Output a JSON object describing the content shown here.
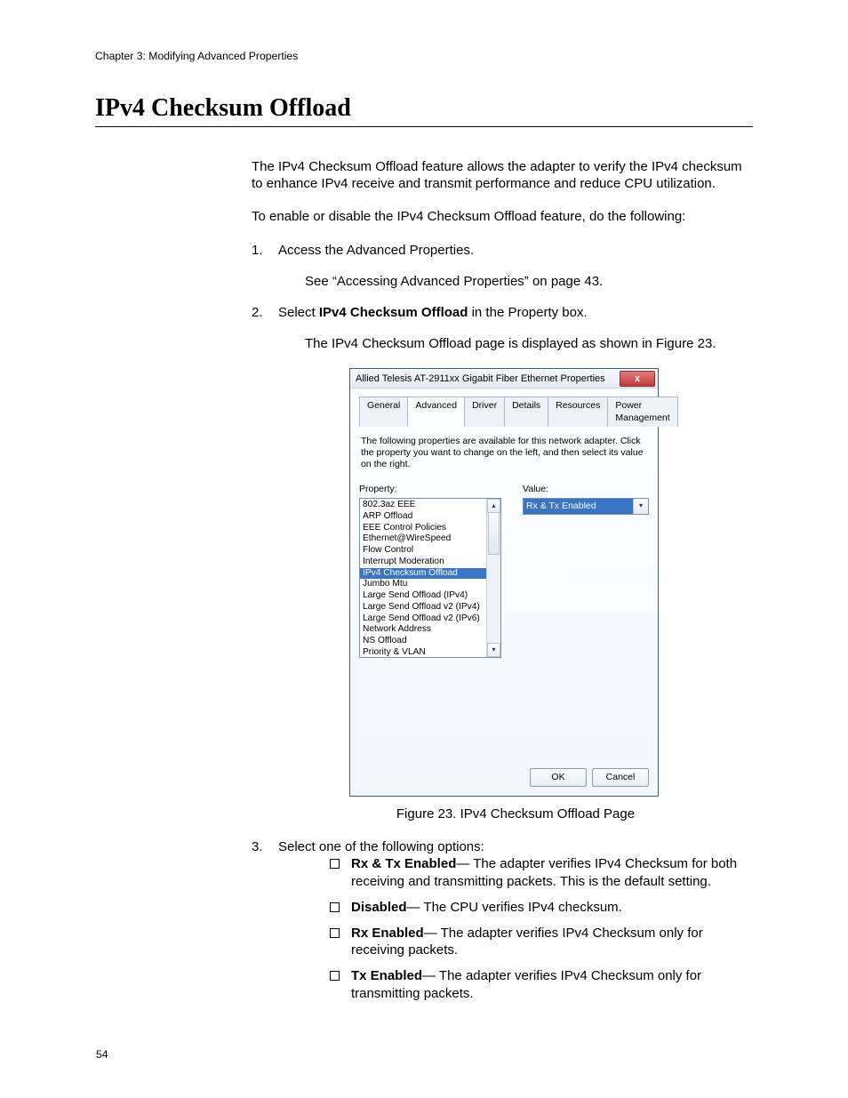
{
  "header": {
    "chapter": "Chapter 3: Modifying Advanced Properties",
    "page_number": "54"
  },
  "title": "IPv4 Checksum Offload",
  "intro": "The IPv4 Checksum Offload feature allows the adapter to verify the IPv4 checksum to enhance IPv4 receive and transmit performance and reduce CPU utilization.",
  "lead": "To enable or disable the IPv4 Checksum Offload feature, do the following:",
  "steps": {
    "s1": "Access the Advanced Properties.",
    "s1_sub": "See “Accessing Advanced Properties” on page 43.",
    "s2_a": "Select ",
    "s2_b": "IPv4 Checksum Offload",
    "s2_c": " in the Property box.",
    "s2_sub": "The IPv4 Checksum Offload page is displayed as shown in Figure 23.",
    "s3": "Select one of the following options:"
  },
  "options": {
    "o1_b": "Rx & Tx Enabled",
    "o1_t": "— The adapter verifies IPv4 Checksum for both receiving and transmitting packets. This is the default setting.",
    "o2_b": "Disabled",
    "o2_t": "— The CPU verifies IPv4 checksum.",
    "o3_b": "Rx Enabled",
    "o3_t": "— The adapter verifies IPv4 Checksum only for receiving packets.",
    "o4_b": "Tx Enabled",
    "o4_t": "— The adapter verifies IPv4 Checksum only for transmitting packets."
  },
  "figure_caption": "Figure 23. IPv4 Checksum Offload Page",
  "dialog": {
    "title": "Allied Telesis AT-2911xx Gigabit Fiber Ethernet Properties",
    "tabs": [
      "General",
      "Advanced",
      "Driver",
      "Details",
      "Resources",
      "Power Management"
    ],
    "active_tab_index": 1,
    "description": "The following properties are available for this network adapter. Click the property you want to change on the left, and then select its value on the right.",
    "property_label": "Property:",
    "value_label": "Value:",
    "properties": [
      "802.3az EEE",
      "ARP Offload",
      "EEE Control Policies",
      "Ethernet@WireSpeed",
      "Flow Control",
      "Interrupt Moderation",
      "IPv4 Checksum Offload",
      "Jumbo Mtu",
      "Large Send Offload (IPv4)",
      "Large Send Offload v2 (IPv4)",
      "Large Send Offload v2 (IPv6)",
      "Network Address",
      "NS Offload",
      "Priority & VLAN"
    ],
    "selected_property_index": 6,
    "value_selected": "Rx & Tx Enabled",
    "ok": "OK",
    "cancel": "Cancel"
  }
}
